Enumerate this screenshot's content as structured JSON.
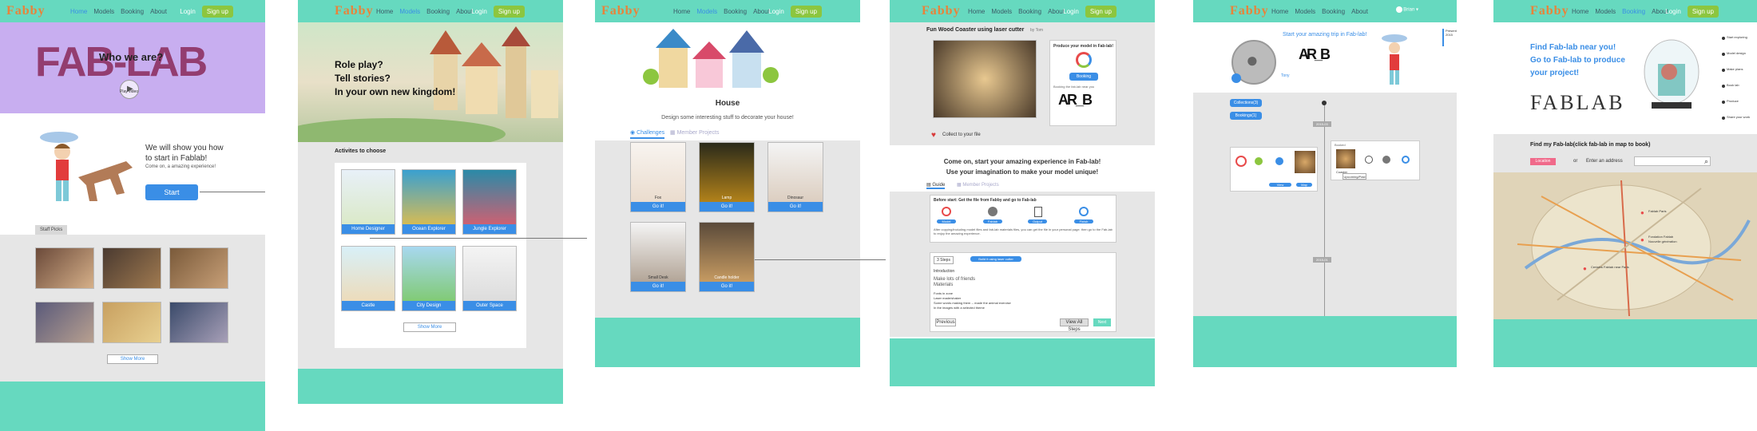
{
  "nav": {
    "logo": "Fabby",
    "links": [
      "Home",
      "Models",
      "Booking",
      "About"
    ],
    "login": "Login",
    "signup": "Sign up"
  },
  "s1": {
    "hero_logo": "FAB-LAB",
    "who": "Who we are?",
    "play": "Play video",
    "line1": "We will show you how",
    "line2": "to start in Fablab!",
    "sub": "Come on, a amazing experience!",
    "start": "Start",
    "staff_tab": "Staff Picks",
    "show_more": "Show More"
  },
  "s2": {
    "hero1": "Role play?",
    "hero2": "Tell stories?",
    "hero3": "In your own new kingdom!",
    "section": "Activites to choose",
    "cards": [
      "Home Designer",
      "Ocean Explorer",
      "Jungle Explorer",
      "Castle",
      "City Design",
      "Outer Space"
    ],
    "show_more": "Show More"
  },
  "s3": {
    "title": "House",
    "subtitle": "Design some interesting stuff to decorate your house!",
    "tab1": "Challenges",
    "tab2": "Member Projects",
    "items": [
      "Fox",
      "Lamp",
      "Dinosaur",
      "Small Desk",
      "Candle holder"
    ],
    "go": "Go it!"
  },
  "s4": {
    "title": "Fun Wood Coaster using laser cutter",
    "by": "by Tom",
    "produce": "Produce your model in Fab-lab!",
    "booking": "Booking",
    "booking_note": "Booking the fab-lab near you",
    "collect": "Collect to your file",
    "cta1": "Come on, start your amazing experience in Fab-lab!",
    "cta2": "Use your imagination to make your model unique!",
    "tab1": "Guide",
    "tab2": "Member Projects",
    "before": "Before start: Get the file from Fabby and go to Fab-lab",
    "steps": [
      "Model",
      "Fablab",
      "Output",
      "Finish"
    ],
    "note": "After copying/including model files and fab-lab materials files, you can get the file in your personal page. then go to the Fab-lab to enjoy the amazing experience.",
    "steps_count": "3 Steps",
    "step_title": "Build it using laser cutter",
    "intro": "Introduction",
    "intro_lines": [
      "Make lots of friends",
      "Materials",
      "",
      "Fonts in zone",
      "Laser made/shaker",
      "Some words making them -- made the animal exercise",
      "In the images with a selected theme"
    ],
    "prev": "Previous",
    "all_steps": "View All Steps",
    "next": "Next"
  },
  "s5": {
    "user_menu": "Brian",
    "tagline": "Start your amazing trip in Fab-lab!",
    "name": "Tony",
    "collections": "Collections(3)",
    "bookings": "Bookings(1)",
    "timeline_top": "2015-03",
    "timeline_mid": "2015-01",
    "sidebar": [
      "Present",
      "2015"
    ],
    "booked": "Booked",
    "coaster": "Coaster",
    "pending": "Upcoming/Past",
    "map_btn": "Map",
    "view_btn": "View"
  },
  "s6": {
    "headline1": "Find Fab-lab near you!",
    "headline2": "Go to Fab-lab to produce",
    "headline3": "your project!",
    "brand": "FABLAB",
    "find": "Find my Fab-lab(click fab-lab in map to book)",
    "location_btn": "Location",
    "or": "or",
    "address_label": "Enter an address",
    "steps": [
      "Start exploring",
      "Model design",
      "Make plans",
      "Book lab",
      "Produce",
      "Share your work"
    ],
    "pins": [
      "Fablab Paris",
      "Fondation Fablab",
      "Nouvelle génération",
      "Certains Fablab near Paris"
    ]
  },
  "colors": {
    "teal": "#66d9bf",
    "blue": "#3a8ee6",
    "green": "#8cc63f",
    "purple": "#c8aef0",
    "pink": "#f06a8a"
  }
}
